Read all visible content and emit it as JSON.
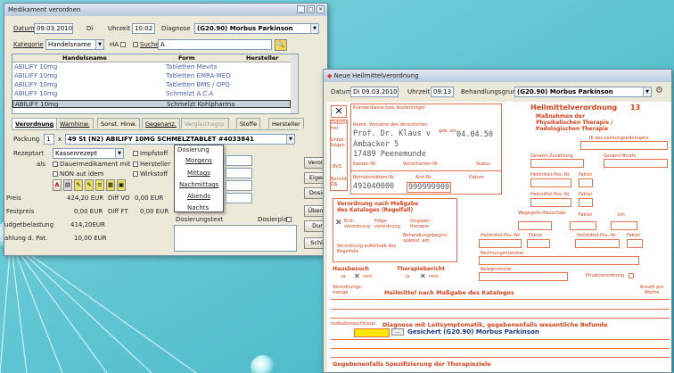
{
  "left": {
    "title": "Medikament verordnen",
    "datum_label": "Datum",
    "datum": "09.03.2010",
    "weekday": "Di",
    "uhrzeit_label": "Uhrzeit",
    "uhrzeit": "10:02",
    "diagnose_label": "Diagnose",
    "diagnose": "(G20.90) Morbus Parkinson",
    "kategorie_label": "Kategorie",
    "kategorie": "Handelsname",
    "ha_label": "HA",
    "suche_label": "Suche",
    "suche_value": "A",
    "col_handel": "Handelsname",
    "col_form": "Form",
    "col_hersteller": "Hersteller",
    "rows": [
      {
        "name": "ABILIFY 10mg",
        "form": "Tabletten Mevits"
      },
      {
        "name": "ABILIFY 10mg",
        "form": "Tabletten EMRA-MED"
      },
      {
        "name": "ABILIFY 10mg",
        "form": "Tabletten BMS / OPQ"
      },
      {
        "name": "ABILIFY 10mg",
        "form": "Schmelzt A.C.A"
      },
      {
        "name": "ABILIFY 10mg",
        "form": "Schmelzt Kohlpharma"
      }
    ],
    "tabs": [
      "Verordnung",
      "Warnhinw.",
      "Sonst. Hinw.",
      "Gegenanz.",
      "Vergleichsgrp.",
      "Stoffe",
      "Hersteller"
    ],
    "packung_label": "Packung",
    "packung_qty": "1",
    "packung_x": "x",
    "packung_value": "49 St (N2) ABILIFY 10MG SCHMELZTABLET #4033841",
    "rezeptart_label": "Rezeptart",
    "rezeptart": "Kassenrezept",
    "impfstoff": "Impfstoff",
    "als_label": "als",
    "dauer": "Dauermedikament",
    "mit_label": "mit",
    "hersteller_cb": "Hersteller",
    "non_aut": "NON aut idem",
    "wirkstoff": "Wirkstoff",
    "dosierung_title": "Dosierung",
    "dos": [
      "Morgens",
      "Mittags",
      "Nachmittags",
      "Abends",
      "Nachts"
    ],
    "preis_label": "Preis",
    "preis": "424,20 EUR",
    "diffvo_label": "Diff VO",
    "diffvo": "0,00 EUR",
    "festpreis_label": "Festpreis",
    "festpreis": "0,00 EUR",
    "diffft_label": "Diff FT",
    "diffft": "0,00 EUR",
    "budget_label": "udgetbelastung",
    "budget": "414,20EUR",
    "zuzahlung_label": "ahlung d. Pat.",
    "zuzahlung": "10,00 EUR",
    "dosiertext_label": "Dosierungstext",
    "dosierplan_label": "Dosierplan",
    "side_btns": [
      "Verord",
      "Eigen",
      "Dosie",
      "Überni",
      "Dur",
      "Schli"
    ]
  },
  "right": {
    "title": "Neue Heilmittelverordnung",
    "datum_label": "Datum",
    "datum": "Di 09.03.2010",
    "uhrzeit_label": "Uhrzeit",
    "uhrzeit": "09:13",
    "grund_label": "Behandlungsgrund",
    "grund": "(G20.90) Morbus Parkinson",
    "krankenkasse_label": "Krankenkasse bzw. Kostenträger",
    "name_label": "Name, Vorname des Versicherten",
    "geb_label": "geb. am",
    "patient_name": "Prof. Dr. Klaus v",
    "patient_geb": "04.04.50",
    "patient_street": "Ambacker 5",
    "patient_city": "17489 Peenemunde",
    "kassen_label": "Kassen-Nr.",
    "versnr_label": "Versicherten-Nr.",
    "status_label": "Status",
    "betrieb_label": "Betriebsstätten-Nr.",
    "arzt_label": "Arzt-Nr.",
    "datum_small": "Datum",
    "betrieb_nr": "491040000",
    "arzt_nr": "999999900",
    "side_labels": [
      "Gebühr frei",
      "Unfall-folgen",
      "BVG",
      "Bericht ÖA"
    ],
    "form_title": "Heilmittelverordnung",
    "form_number": "13",
    "form_sub1": "Maßnahmen der",
    "form_sub2": "Physikalischen Therapie /",
    "form_sub3": "Podologischen Therapie",
    "leistungserbr": "IK des Leistungserbringers",
    "gesamt_zuz": "Gesamt-Zuzahlung",
    "gesamt_brutto": "Gesamt-Brutto",
    "heilpos1": "Heilmittel-Pos.-Nr.",
    "faktor": "Faktor",
    "vo_title1": "Verordnung nach Maßgabe",
    "vo_title2": "des Kataloges (Regelfall)",
    "erst": "Erst-verordnung",
    "folge": "Folge-verordnung",
    "gruppe": "Gruppen-therapie",
    "beh_beginn": "Behandlungsbeginn spätest. am",
    "ausserhalb": "Verordnung außerhalb des Regelfalls",
    "wegegeld": "Wegegeld-/Pauschale",
    "km": "km",
    "hausbesuch": "Hausbesuch",
    "therapie": "Therapiebericht",
    "ja": "ja",
    "nein": "nein",
    "rechnungsnr": "Rechnungsnummer",
    "belegnummer": "Belegnummer",
    "privat": "Privatverordnung",
    "vo_menge": "Verordnungs-menge",
    "heilmittel_label": "Heilmittel nach Maßgabe des Kataloges",
    "anzahl": "Anzahl pro Woche",
    "indik_label": "Indikationsschlüssel",
    "diagnose_label": "Diagnose mit Leitsymptomatik, gegebenenfalls wesentliche Befunde",
    "diagnose_value": "Gesichert (G20.90) Morbus Parkinson",
    "spezif": "Gegebenenfalls Spezifizierung der Therapieziele"
  }
}
